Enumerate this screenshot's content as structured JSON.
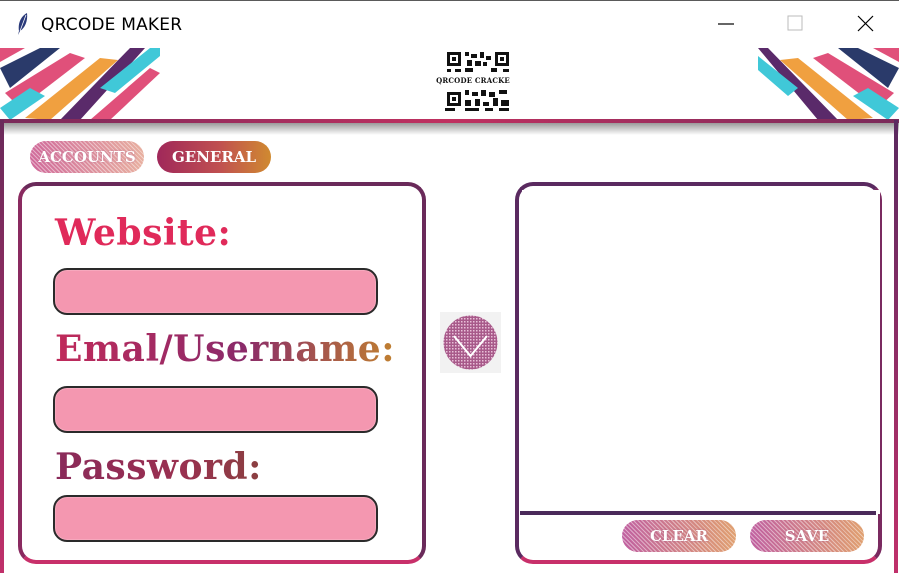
{
  "window": {
    "title": "QRCODE MAKER",
    "icon": "feather-icon",
    "controls": [
      "minimize-icon",
      "maximize-icon",
      "close-icon"
    ]
  },
  "banner": {
    "logo_text": "QRCODE CRACKE"
  },
  "tabs": {
    "accounts": "ACCOUNTS",
    "general": "GENERAL"
  },
  "form": {
    "website_label": "Website:",
    "website_value": "",
    "email_label": "Emal/Username:",
    "email_value": "",
    "password_label": "Password:",
    "password_value": ""
  },
  "output": {
    "text": "",
    "clear_label": "CLEAR",
    "save_label": "SAVE"
  },
  "colors": {
    "field_fill": "#f497b0",
    "accent_red": "#e02a5a",
    "accent_purple": "#6a2a5a",
    "accent_orange": "#d08a30"
  }
}
